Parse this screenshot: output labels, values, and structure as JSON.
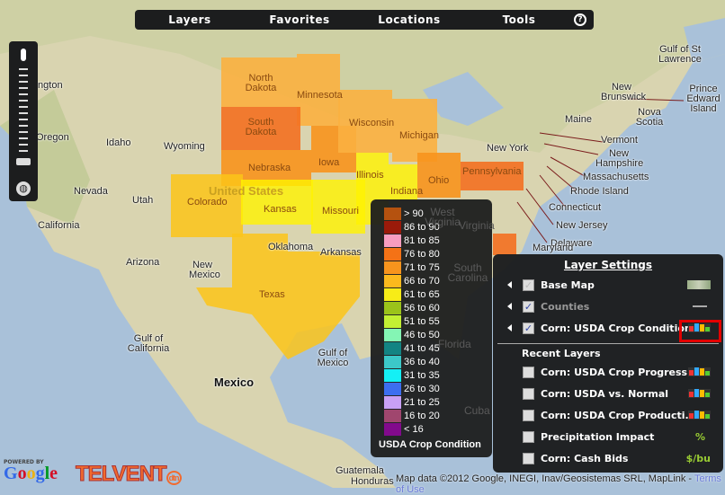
{
  "nav": {
    "items": [
      "Layers",
      "Favorites",
      "Locations",
      "Tools"
    ],
    "help": "?"
  },
  "map": {
    "labels": {
      "country_us": "United States",
      "mexico": "Mexico",
      "gulf_california": "Gulf of California",
      "gulf_mexico": "Gulf of Mexico",
      "washington": "shington",
      "oregon": "Oregon",
      "idaho": "Idaho",
      "wyoming": "Wyoming",
      "nevada": "Nevada",
      "utah": "Utah",
      "california": "California",
      "arizona": "Arizona",
      "new_mexico": "New Mexico",
      "oklahoma": "Oklahoma",
      "arkansas": "Arkansas",
      "texas": "Texas",
      "colorado": "Colorado",
      "kansas": "Kansas",
      "nebraska": "Nebraska",
      "south_dakota": "South Dakota",
      "north_dakota": "North Dakota",
      "minnesota": "Minnesota",
      "iowa": "Iowa",
      "wisconsin": "Wisconsin",
      "michigan": "Michigan",
      "illinois": "Illinois",
      "indiana": "Indiana",
      "ohio": "Ohio",
      "missouri": "Missouri",
      "pennsylvania": "Pennsylvania",
      "new_york": "New York",
      "maine": "Maine",
      "vermont": "Vermont",
      "new_hampshire": "New Hampshire",
      "massachusetts": "Massachusetts",
      "rhode_island": "Rhode Island",
      "connecticut": "Connecticut",
      "new_jersey": "New Jersey",
      "delaware": "Delaware",
      "maryland": "Maryland",
      "new_brunswick": "New Brunswick",
      "nova_scotia": "Nova Scotia",
      "pei": "Prince Edward Island",
      "gulf_st_lawrence": "Gulf of St Lawrence",
      "west_virginia": "West Virginia",
      "virginia": "Virginia",
      "south_carolina": "South Carolina",
      "guatemala": "Guatemala",
      "honduras": "Honduras",
      "cuba": "Cuba",
      "florida": "Florida"
    },
    "state_colors": {
      "orange": "#f7941d",
      "light_orange": "#fbb040",
      "dark_orange": "#f37021",
      "yellow": "#fff200",
      "gold": "#fcc419"
    }
  },
  "legend": {
    "title": "USDA Crop Condition",
    "items": [
      {
        "label": "> 90",
        "color": "#b5520f"
      },
      {
        "label": "86 to 90",
        "color": "#9a1a0a"
      },
      {
        "label": "81 to 85",
        "color": "#f79dc0"
      },
      {
        "label": "76 to 80",
        "color": "#f47216"
      },
      {
        "label": "71 to 75",
        "color": "#f7941d"
      },
      {
        "label": "66 to 70",
        "color": "#fbb91d"
      },
      {
        "label": "61 to 65",
        "color": "#f7ec17"
      },
      {
        "label": "56 to 60",
        "color": "#9bc31a"
      },
      {
        "label": "51 to 55",
        "color": "#c3f033"
      },
      {
        "label": "46 to 50",
        "color": "#84f5b4"
      },
      {
        "label": "41 to 45",
        "color": "#138483"
      },
      {
        "label": "36 to 40",
        "color": "#3cc8c8"
      },
      {
        "label": "31 to 35",
        "color": "#14f0f5"
      },
      {
        "label": "26 to 30",
        "color": "#3c6ef0"
      },
      {
        "label": "21 to 25",
        "color": "#c8a0f5"
      },
      {
        "label": "16 to 20",
        "color": "#a0466e"
      },
      {
        "label": "< 16",
        "color": "#820a8c"
      }
    ]
  },
  "panel": {
    "title": "Layer Settings",
    "layers": [
      {
        "label": "Base Map",
        "checked": true,
        "icon": "map-thumbnail-icon"
      },
      {
        "label": "Counties",
        "checked": true,
        "icon": "line-icon"
      },
      {
        "label": "Corn: USDA Crop Condition",
        "checked": true,
        "icon": "bar-legend-icon"
      }
    ],
    "recent_title": "Recent Layers",
    "recent": [
      {
        "label": "Corn: USDA Crop Progress",
        "icon": "bar-legend-icon"
      },
      {
        "label": "Corn: USDA vs. Normal",
        "icon": "bar-legend-icon"
      },
      {
        "label": "Corn: USDA Crop Producti...",
        "icon": "bar-legend-icon"
      },
      {
        "label": "Precipitation Impact",
        "unit": "%"
      },
      {
        "label": "Corn: Cash Bids",
        "unit": "$/bu"
      }
    ],
    "highlight_color": "#e30000"
  },
  "footer": {
    "attribution": "Map data ©2012 Google, INEGI, Inav/Geosistemas SRL, MapLink - ",
    "terms": "Terms of Use"
  },
  "logos": {
    "powered": "POWERED BY",
    "google": "Google",
    "telvent": "TELVENT",
    "dtn": "dtn"
  }
}
